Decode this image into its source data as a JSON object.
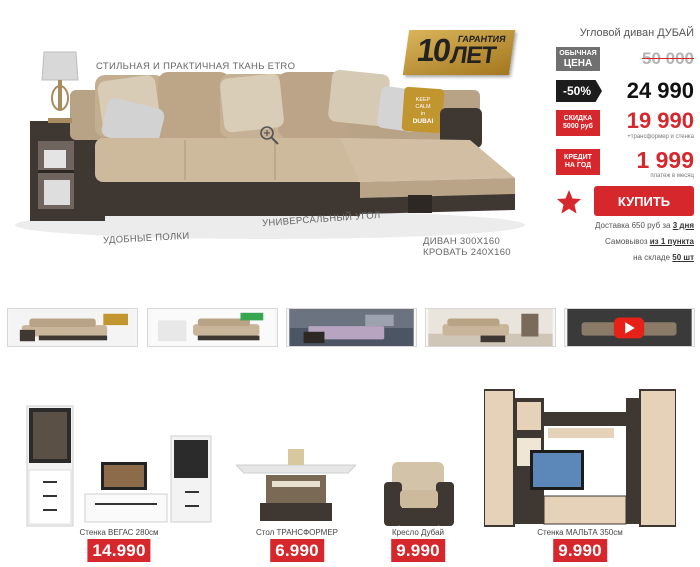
{
  "hero": {
    "captions": {
      "fabric": "СТИЛЬНАЯ И ПРАКТИЧНАЯ ТКАНЬ ETRO",
      "shelves": "УДОБНЫЕ ПОЛКИ",
      "corner": "УНИВЕРСАЛЬНЫЙ УГОЛ",
      "size_sofa": "ДИВАН 300x160",
      "size_bed": "КРОВАТЬ 240x160"
    },
    "guarantee": {
      "number": "10",
      "word": "ГАРАНТИЯ",
      "unit": "ЛЕТ"
    },
    "pillow_text": [
      "KEEP",
      "CALM",
      "in",
      "DUBAI"
    ]
  },
  "product": {
    "title": "Угловой диван ДУБАЙ",
    "regular": {
      "tag_line1": "ОБЫЧНАЯ",
      "tag_line2": "ЦЕНА",
      "value": "50 000"
    },
    "discount": {
      "tag": "-50%",
      "value": "24 990"
    },
    "promo": {
      "tag_line1": "СКИДКА",
      "tag_line2": "5000 руб",
      "value": "19 990",
      "note": "+трансформер и стенка"
    },
    "credit": {
      "tag_line1": "КРЕДИТ",
      "tag_line2": "НА ГОД",
      "value": "1 999",
      "note": "платеж в месяц"
    },
    "buy_label": "КУПИТЬ",
    "delivery": {
      "text": "Доставка 650 руб за",
      "value": "3 дня"
    },
    "pickup": {
      "text": "Самовывоз",
      "value": "из 1 пункта"
    },
    "stock": {
      "text": "на складе",
      "value": "50 шт"
    }
  },
  "thumbnails": [
    {
      "name": "sofa-guarantee"
    },
    {
      "name": "sofa-features"
    },
    {
      "name": "sofa-bed-room"
    },
    {
      "name": "sofa-living-room"
    },
    {
      "name": "video",
      "icon": "play-icon"
    }
  ],
  "related": [
    {
      "name": "Стенка ВЕГАС 280см",
      "price": "14.990"
    },
    {
      "name": "Стол ТРАНСФОРМЕР",
      "price": "6.990"
    },
    {
      "name": "Кресло Дубай",
      "price": "9.990"
    },
    {
      "name": "Стенка МАЛЬТА 350см",
      "price": "9.990"
    }
  ],
  "colors": {
    "accent": "#d6272c",
    "fabric": "#c9b59a",
    "leather": "#3d3530",
    "gold": "#c2962f"
  }
}
